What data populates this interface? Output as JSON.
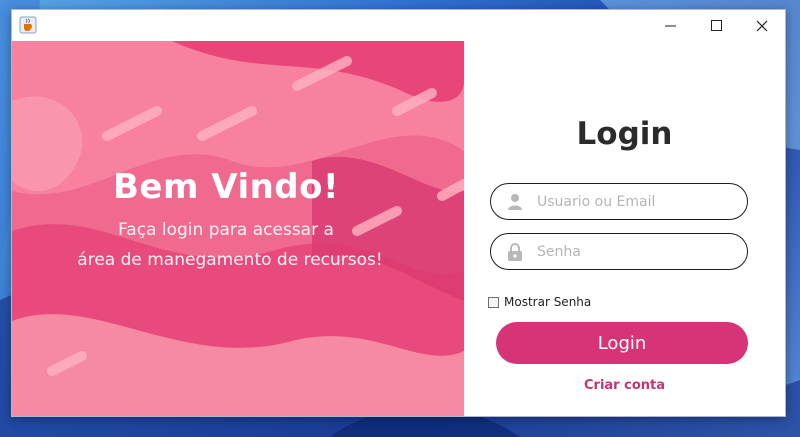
{
  "window": {
    "icon": "java-cup-icon",
    "controls": [
      "minimize-icon",
      "maximize-icon",
      "close-icon"
    ]
  },
  "welcome": {
    "title": "Bem Vindo!",
    "subtitle_line1": "Faça login para acessar a",
    "subtitle_line2": "área de manegamento de recursos!",
    "background_color": "#f06a8f"
  },
  "login": {
    "title": "Login",
    "username_placeholder": "Usuario ou Email",
    "username_icon": "user-icon",
    "password_placeholder": "Senha",
    "password_icon": "lock-icon",
    "show_password_label": "Mostrar Senha",
    "show_password_checked": false,
    "login_button_label": "Login",
    "create_account_label": "Criar conta",
    "accent_color": "#d63477"
  }
}
